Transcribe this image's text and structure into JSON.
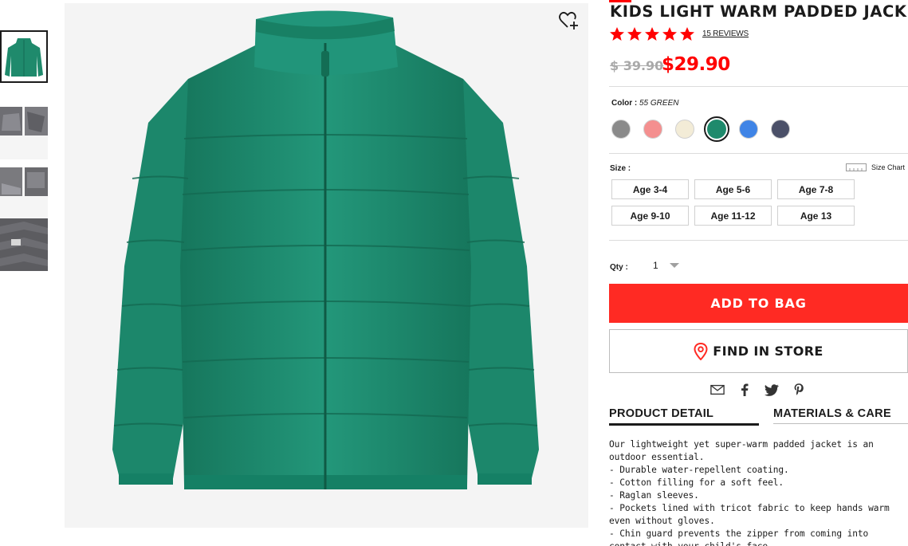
{
  "product": {
    "title": "KIDS LIGHT WARM PADDED JACKET",
    "rating": 5,
    "reviews_label": "15 REVIEWS",
    "price_original": "$ 39.90",
    "price_sale": "$29.90"
  },
  "color": {
    "label": "Color :",
    "selected_name": "55 GREEN",
    "options": [
      {
        "name": "gray",
        "hex": "#8a8a8a",
        "selected": false
      },
      {
        "name": "pink",
        "hex": "#f48f8f",
        "selected": false
      },
      {
        "name": "cream",
        "hex": "#f3ecd7",
        "selected": false
      },
      {
        "name": "green",
        "hex": "#1f8a6c",
        "selected": true
      },
      {
        "name": "blue",
        "hex": "#3f84e6",
        "selected": false
      },
      {
        "name": "navy",
        "hex": "#4b5068",
        "selected": false
      }
    ]
  },
  "size": {
    "label": "Size :",
    "chart_label": "Size Chart",
    "options": [
      "Age 3-4",
      "Age 5-6",
      "Age 7-8",
      "Age 9-10",
      "Age 11-12",
      "Age 13"
    ]
  },
  "qty": {
    "label": "Qty :",
    "value": "1"
  },
  "actions": {
    "add_to_bag": "ADD TO BAG",
    "find_in_store": "FIND IN STORE"
  },
  "share_icons": [
    "mail-icon",
    "facebook-icon",
    "twitter-icon",
    "pinterest-icon"
  ],
  "tabs": {
    "detail": "PRODUCT DETAIL",
    "materials": "MATERIALS & CARE"
  },
  "description": [
    "Our lightweight yet super-warm padded jacket is an outdoor essential.",
    "- Durable water-repellent coating.",
    "- Cotton filling for a soft feel.",
    "- Raglan sleeves.",
    "- Pockets lined with tricot fabric to keep hands warm even without gloves.",
    "- Chin guard prevents the zipper from coming into contact with your child's face."
  ],
  "colors": {
    "accent_red": "#ff2a23",
    "jacket_green": "#1f8a6c"
  }
}
